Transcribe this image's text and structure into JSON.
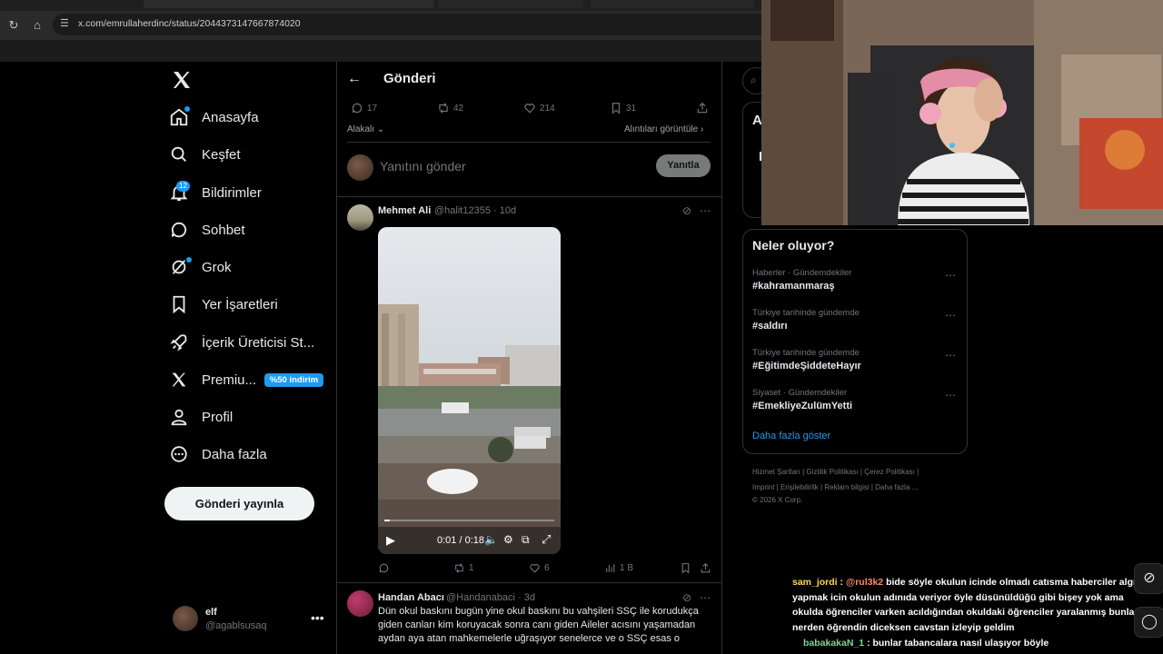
{
  "browser": {
    "url": "x.com/emrullaherdinc/status/2044373147667874020"
  },
  "sidebar": {
    "items": [
      {
        "label": "Anasayfa",
        "icon": "home-icon"
      },
      {
        "label": "Keşfet",
        "icon": "search-icon"
      },
      {
        "label": "Bildirimler",
        "icon": "bell-icon",
        "badge": "12"
      },
      {
        "label": "Sohbet",
        "icon": "chat-icon"
      },
      {
        "label": "Grok",
        "icon": "grok-icon"
      },
      {
        "label": "Yer İşaretleri",
        "icon": "bookmark-icon"
      },
      {
        "label": "İçerik Üreticisi St...",
        "icon": "rocket-icon"
      },
      {
        "label": "Premiu...",
        "icon": "x-icon",
        "promo": "%50 indirim"
      },
      {
        "label": "Profil",
        "icon": "person-icon"
      },
      {
        "label": "Daha fazla",
        "icon": "more-circle-icon"
      }
    ],
    "post_button": "Gönderi yayınla",
    "profile": {
      "name": "elf",
      "handle": "@agablsusaq"
    }
  },
  "main": {
    "title": "Gönderi",
    "actions": {
      "replies": "17",
      "reposts": "42",
      "likes": "214",
      "bookmarks": "31"
    },
    "sort_label": "Alakalı",
    "quotes_label": "Alıntıları görüntüle",
    "reply_placeholder": "Yanıtını gönder",
    "reply_button": "Yanıtla",
    "tweets": [
      {
        "name": "Mehmet Ali",
        "handle": "@halit12355",
        "time": "10d",
        "video_time": "0:01 / 0:18",
        "video_progress": 0.03,
        "replies": "",
        "reposts": "1",
        "likes": "6",
        "views": "1 B"
      },
      {
        "name": "Handan Abacı",
        "handle": "@Handanabaci",
        "time": "3d",
        "text": "Dün okul baskını bugün yine okul baskını bu vahşileri SSÇ ile korudukça giden canları kim koruyacak sonra canı giden Aileler acısını yaşamadan aydan aya atan mahkemelerle uğraşıyor senelerce ve o SSÇ esas o"
      }
    ]
  },
  "right": {
    "trends_title": "Neler oluyor?",
    "trends": [
      {
        "context": "Haberler · Gündemdekiler",
        "tag": "#kahramanmaraş"
      },
      {
        "context": "Türkiye tarihinde gündemde",
        "tag": "#saldırı"
      },
      {
        "context": "Türkiye tarihinde gündemde",
        "tag": "#EğitimdeŞiddeteHayır"
      },
      {
        "context": "Siyaset · Gündemdekiler",
        "tag": "#EmekliyeZulümYetti"
      }
    ],
    "show_more": "Daha fazla göster",
    "footer": {
      "line1": "Hizmet Şartları  |  Gizlilik Politikası  |  Çerez Politikası  |",
      "line2": "Imprint  |  Erişilebilirlik  |  Reklam bilgisi  |  Daha fazla ...",
      "line3": "© 2026 X Corp."
    }
  },
  "chat": {
    "msg1_user": "sam_jordi",
    "msg1_mention": "@rul3k2",
    "msg1_text": "bide söyle okulun icinde olmadı catısma haberciler algı yapmak icin okulun adınıda veriyor öyle düsünüldüğü gibi bişey yok ama okulda öğrenciler varken acıldığından okuldaki öğrenciler yaralanmış bunları nerden öğrendin diceksen cavstan izleyip geldim",
    "msg2_user": "babakakaN_1",
    "msg2_text": "bunlar tabancalara nasıl ulaşıyor böyle"
  },
  "colors": {
    "accent": "#1d9bf0",
    "background": "#000000",
    "muted": "#71767b"
  }
}
